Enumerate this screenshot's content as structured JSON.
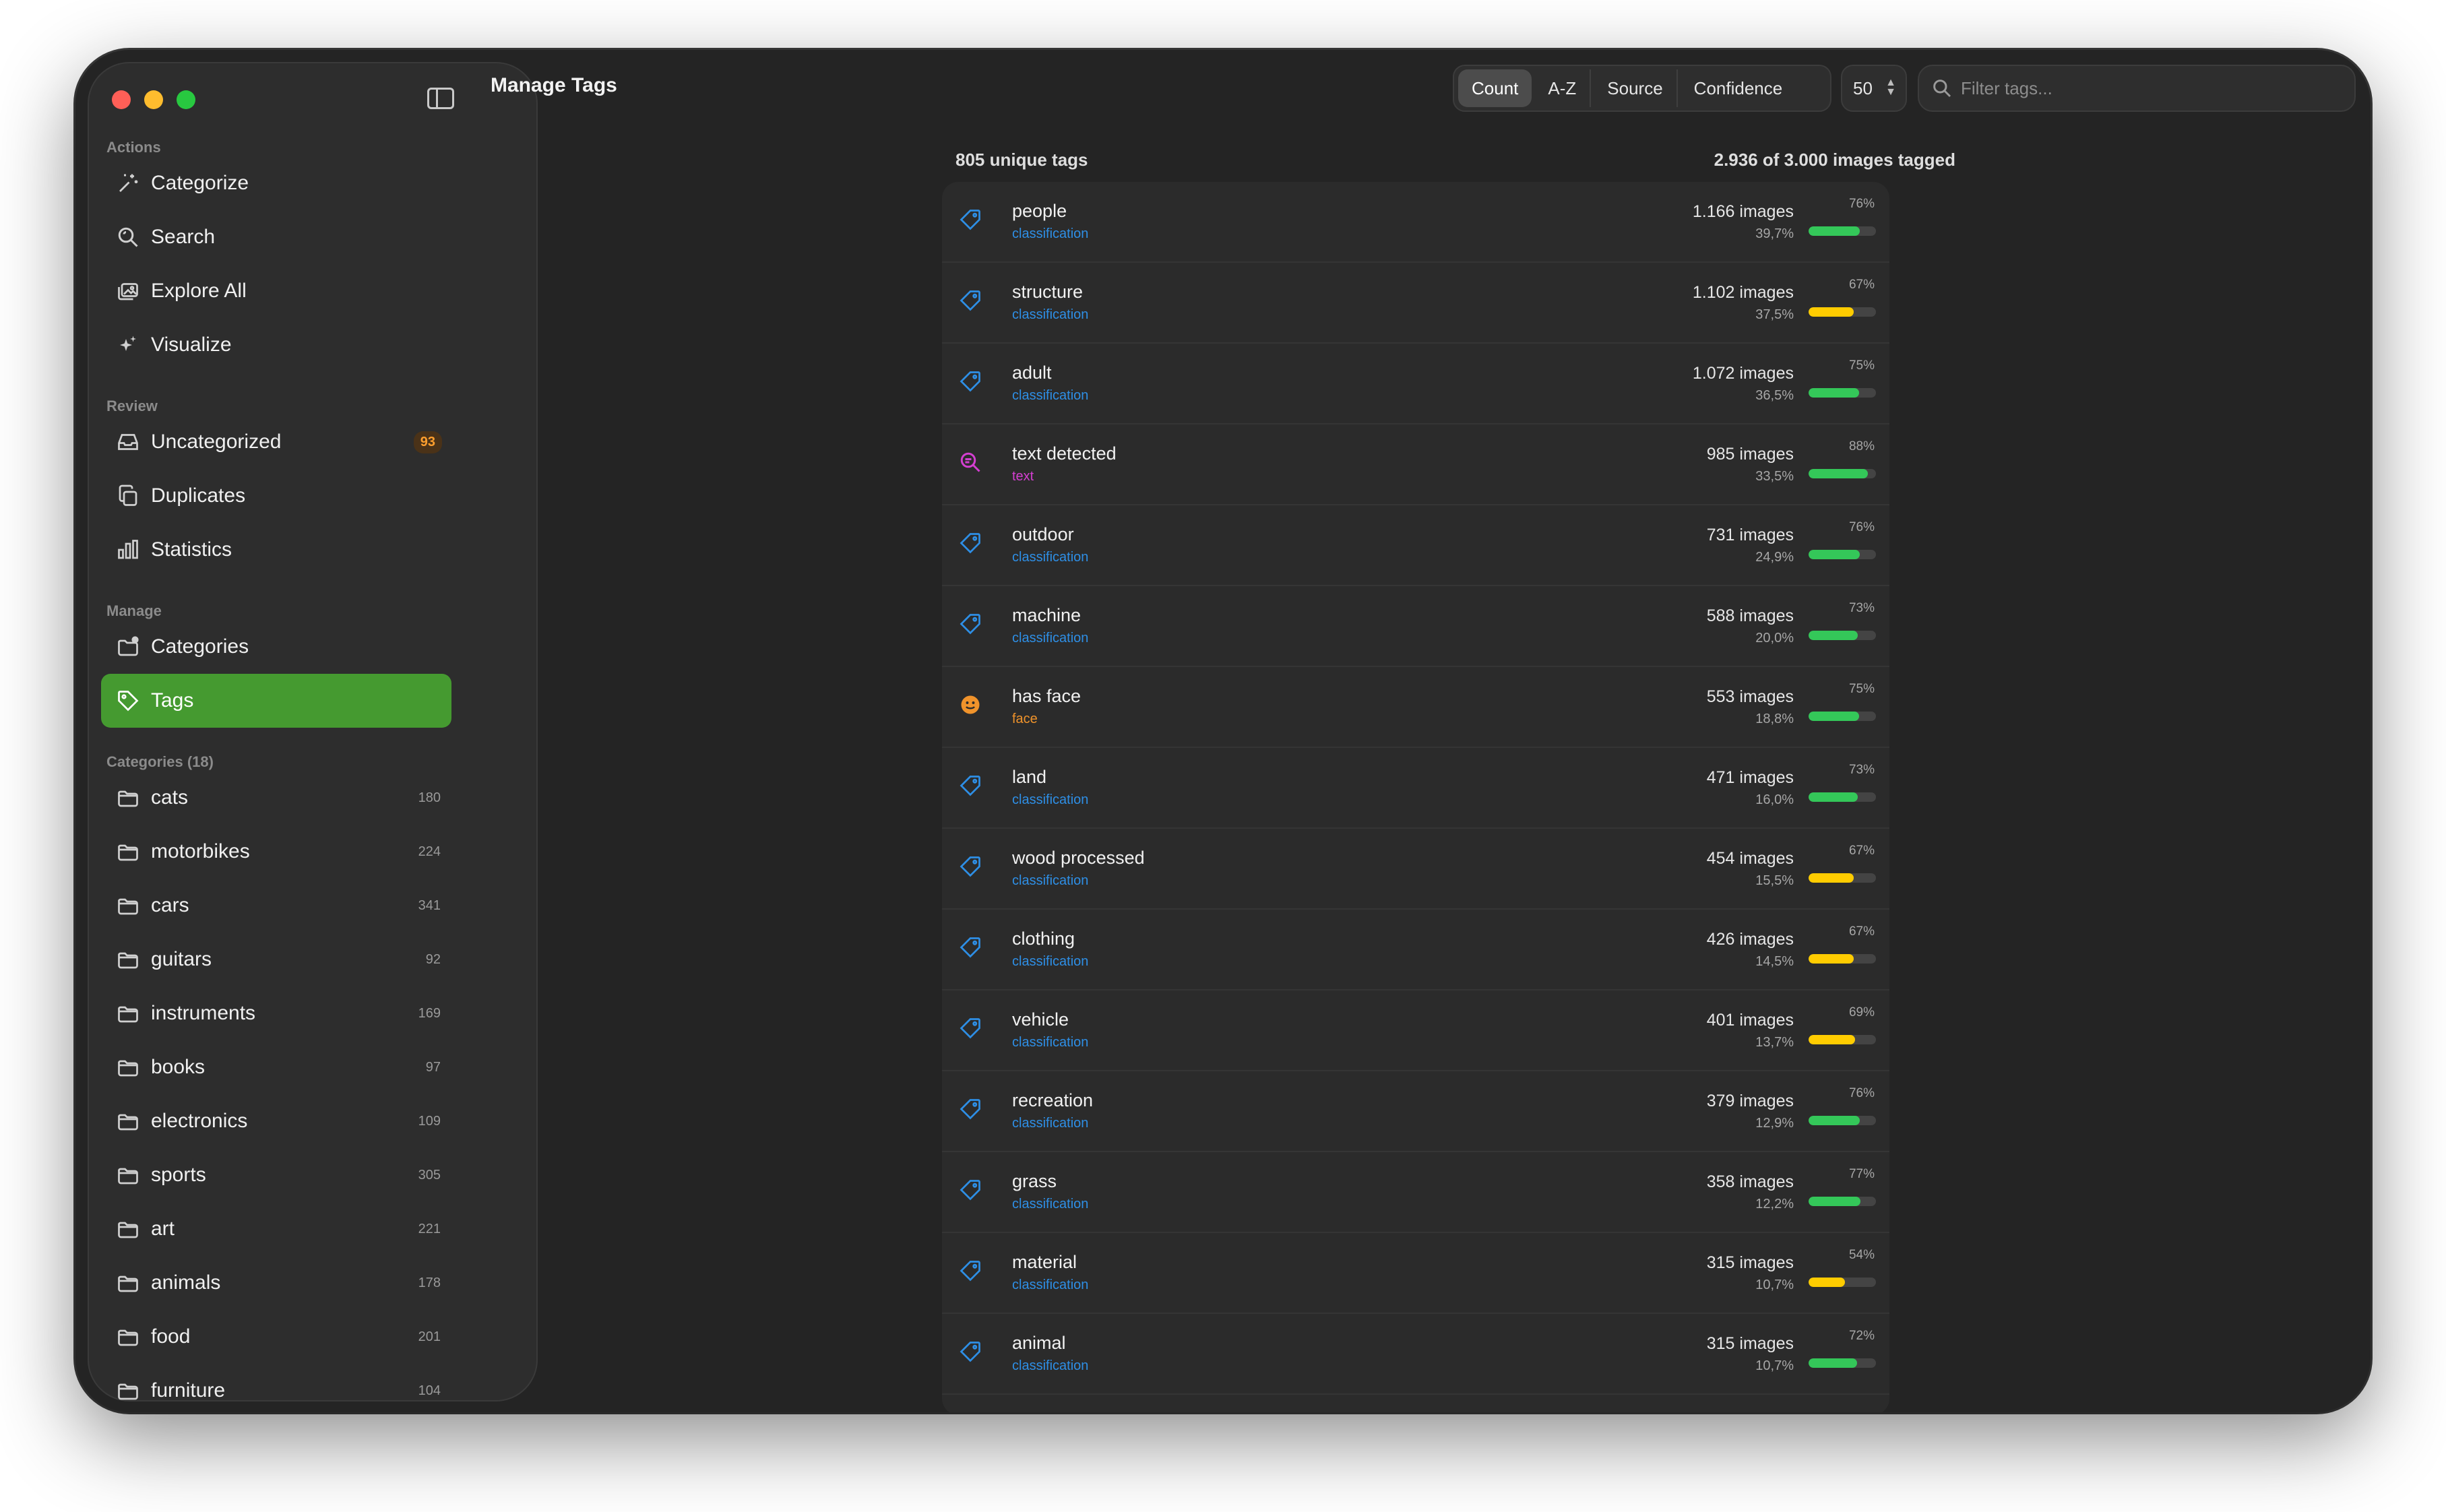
{
  "window": {
    "title": "Manage Tags"
  },
  "sidebar": {
    "sections": {
      "actions": "Actions",
      "review": "Review",
      "manage": "Manage",
      "categories": "Categories (18)"
    },
    "actions": [
      {
        "label": "Categorize",
        "icon": "sparkles-icon"
      },
      {
        "label": "Search",
        "icon": "search-icon"
      },
      {
        "label": "Explore All",
        "icon": "photos-icon"
      },
      {
        "label": "Visualize",
        "icon": "sparkle-icon"
      }
    ],
    "review": [
      {
        "label": "Uncategorized",
        "icon": "inbox-icon",
        "badge": "93"
      },
      {
        "label": "Duplicates",
        "icon": "duplicate-icon"
      },
      {
        "label": "Statistics",
        "icon": "chart-icon"
      }
    ],
    "manage": [
      {
        "label": "Categories",
        "icon": "folder-badge-icon"
      },
      {
        "label": "Tags",
        "icon": "tag-icon",
        "active": true
      }
    ],
    "categories": [
      {
        "label": "cats",
        "count": "180"
      },
      {
        "label": "motorbikes",
        "count": "224"
      },
      {
        "label": "cars",
        "count": "341"
      },
      {
        "label": "guitars",
        "count": "92"
      },
      {
        "label": "instruments",
        "count": "169"
      },
      {
        "label": "books",
        "count": "97"
      },
      {
        "label": "electronics",
        "count": "109"
      },
      {
        "label": "sports",
        "count": "305"
      },
      {
        "label": "art",
        "count": "221"
      },
      {
        "label": "animals",
        "count": "178"
      },
      {
        "label": "food",
        "count": "201"
      },
      {
        "label": "furniture",
        "count": "104"
      }
    ]
  },
  "toolbar": {
    "sort_options": [
      "Count",
      "A-Z",
      "Source",
      "Confidence"
    ],
    "active_sort": "Count",
    "limit": "50",
    "filter_placeholder": "Filter tags..."
  },
  "summary": {
    "unique": "805 unique tags",
    "tagged": "2.936 of 3.000 images tagged"
  },
  "colors": {
    "accent": "#459a30",
    "classification": "#2e8fe6",
    "text": "#d43fd1",
    "face": "#f0932b",
    "bar_high": "#34c759",
    "bar_mid": "#ffcc00"
  },
  "tags": [
    {
      "name": "people",
      "source": "classification",
      "count": "1.166 images",
      "pct": "39,7%",
      "conf": "76%",
      "conf_value": 0.76,
      "icon": "tag-icon"
    },
    {
      "name": "structure",
      "source": "classification",
      "count": "1.102 images",
      "pct": "37,5%",
      "conf": "67%",
      "conf_value": 0.67,
      "icon": "tag-icon"
    },
    {
      "name": "adult",
      "source": "classification",
      "count": "1.072 images",
      "pct": "36,5%",
      "conf": "75%",
      "conf_value": 0.75,
      "icon": "tag-icon"
    },
    {
      "name": "text detected",
      "source": "text",
      "count": "985 images",
      "pct": "33,5%",
      "conf": "88%",
      "conf_value": 0.88,
      "icon": "text-search-icon"
    },
    {
      "name": "outdoor",
      "source": "classification",
      "count": "731 images",
      "pct": "24,9%",
      "conf": "76%",
      "conf_value": 0.76,
      "icon": "tag-icon"
    },
    {
      "name": "machine",
      "source": "classification",
      "count": "588 images",
      "pct": "20,0%",
      "conf": "73%",
      "conf_value": 0.73,
      "icon": "tag-icon"
    },
    {
      "name": "has face",
      "source": "face",
      "count": "553 images",
      "pct": "18,8%",
      "conf": "75%",
      "conf_value": 0.75,
      "icon": "face-icon"
    },
    {
      "name": "land",
      "source": "classification",
      "count": "471 images",
      "pct": "16,0%",
      "conf": "73%",
      "conf_value": 0.73,
      "icon": "tag-icon"
    },
    {
      "name": "wood processed",
      "source": "classification",
      "count": "454 images",
      "pct": "15,5%",
      "conf": "67%",
      "conf_value": 0.67,
      "icon": "tag-icon"
    },
    {
      "name": "clothing",
      "source": "classification",
      "count": "426 images",
      "pct": "14,5%",
      "conf": "67%",
      "conf_value": 0.67,
      "icon": "tag-icon"
    },
    {
      "name": "vehicle",
      "source": "classification",
      "count": "401 images",
      "pct": "13,7%",
      "conf": "69%",
      "conf_value": 0.69,
      "icon": "tag-icon"
    },
    {
      "name": "recreation",
      "source": "classification",
      "count": "379 images",
      "pct": "12,9%",
      "conf": "76%",
      "conf_value": 0.76,
      "icon": "tag-icon"
    },
    {
      "name": "grass",
      "source": "classification",
      "count": "358 images",
      "pct": "12,2%",
      "conf": "77%",
      "conf_value": 0.77,
      "icon": "tag-icon"
    },
    {
      "name": "material",
      "source": "classification",
      "count": "315 images",
      "pct": "10,7%",
      "conf": "54%",
      "conf_value": 0.54,
      "icon": "tag-icon"
    },
    {
      "name": "animal",
      "source": "classification",
      "count": "315 images",
      "pct": "10,7%",
      "conf": "72%",
      "conf_value": 0.72,
      "icon": "tag-icon"
    }
  ]
}
